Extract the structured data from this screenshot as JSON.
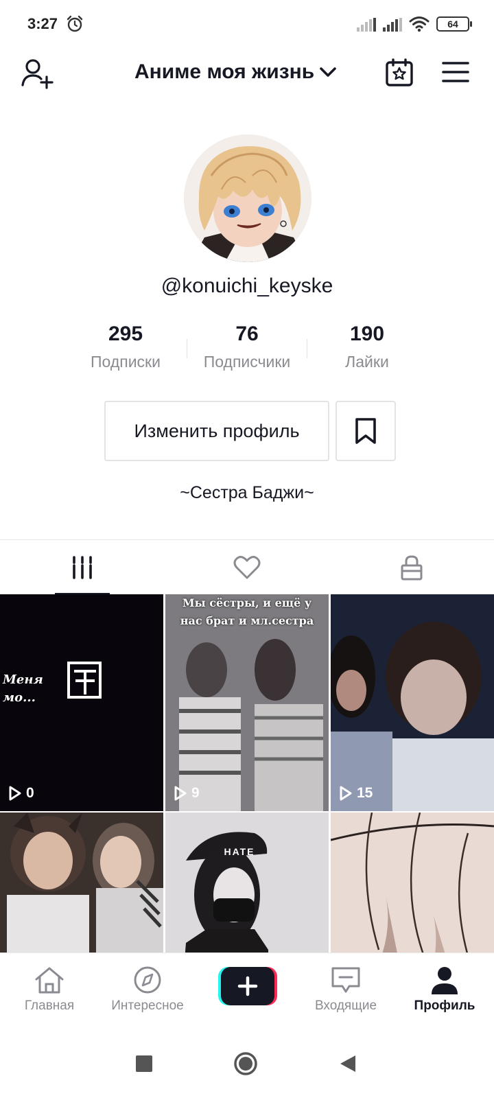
{
  "status_bar": {
    "time": "3:27",
    "battery": "64",
    "icons": [
      "alarm-icon",
      "signal-icon",
      "signal-icon",
      "wifi-icon",
      "battery-icon"
    ]
  },
  "header": {
    "title": "Аниме моя жизнь",
    "icons": [
      "add-user-icon",
      "chevron-down-icon",
      "calendar-star-icon",
      "menu-icon"
    ]
  },
  "profile": {
    "username": "@konuichi_keyske",
    "bio": "~Сестра Баджи~"
  },
  "stats": [
    {
      "value": "295",
      "label": "Подписки"
    },
    {
      "value": "76",
      "label": "Подписчики"
    },
    {
      "value": "190",
      "label": "Лайки"
    }
  ],
  "buttons": {
    "edit_profile": "Изменить профиль",
    "bookmark_icon": "bookmark-icon"
  },
  "tabs": [
    {
      "icon": "videos-grid-icon",
      "active": true
    },
    {
      "icon": "heart-icon",
      "active": false
    },
    {
      "icon": "lock-icon",
      "active": false
    }
  ],
  "videos": [
    {
      "views": "0",
      "caption": "Меня мо..."
    },
    {
      "views": "9",
      "caption": "Мы сёстры, и ещё у нас брат и мл.сестра"
    },
    {
      "views": "15",
      "caption": ""
    },
    {
      "views": "",
      "caption": ""
    },
    {
      "views": "",
      "caption": "HATE"
    },
    {
      "views": "",
      "caption": ""
    }
  ],
  "bottom_nav": [
    {
      "label": "Главная",
      "icon": "home-icon",
      "active": false
    },
    {
      "label": "Интересное",
      "icon": "compass-icon",
      "active": false
    },
    {
      "label": "",
      "icon": "plus-icon",
      "active": false
    },
    {
      "label": "Входящие",
      "icon": "inbox-icon",
      "active": false
    },
    {
      "label": "Профиль",
      "icon": "profile-icon",
      "active": true
    }
  ],
  "colors": {
    "text_primary": "#161823",
    "text_secondary": "#8a8b91",
    "border": "#e3e3e4",
    "accent_cyan": "#25f4ee",
    "accent_pink": "#fe2c55"
  }
}
